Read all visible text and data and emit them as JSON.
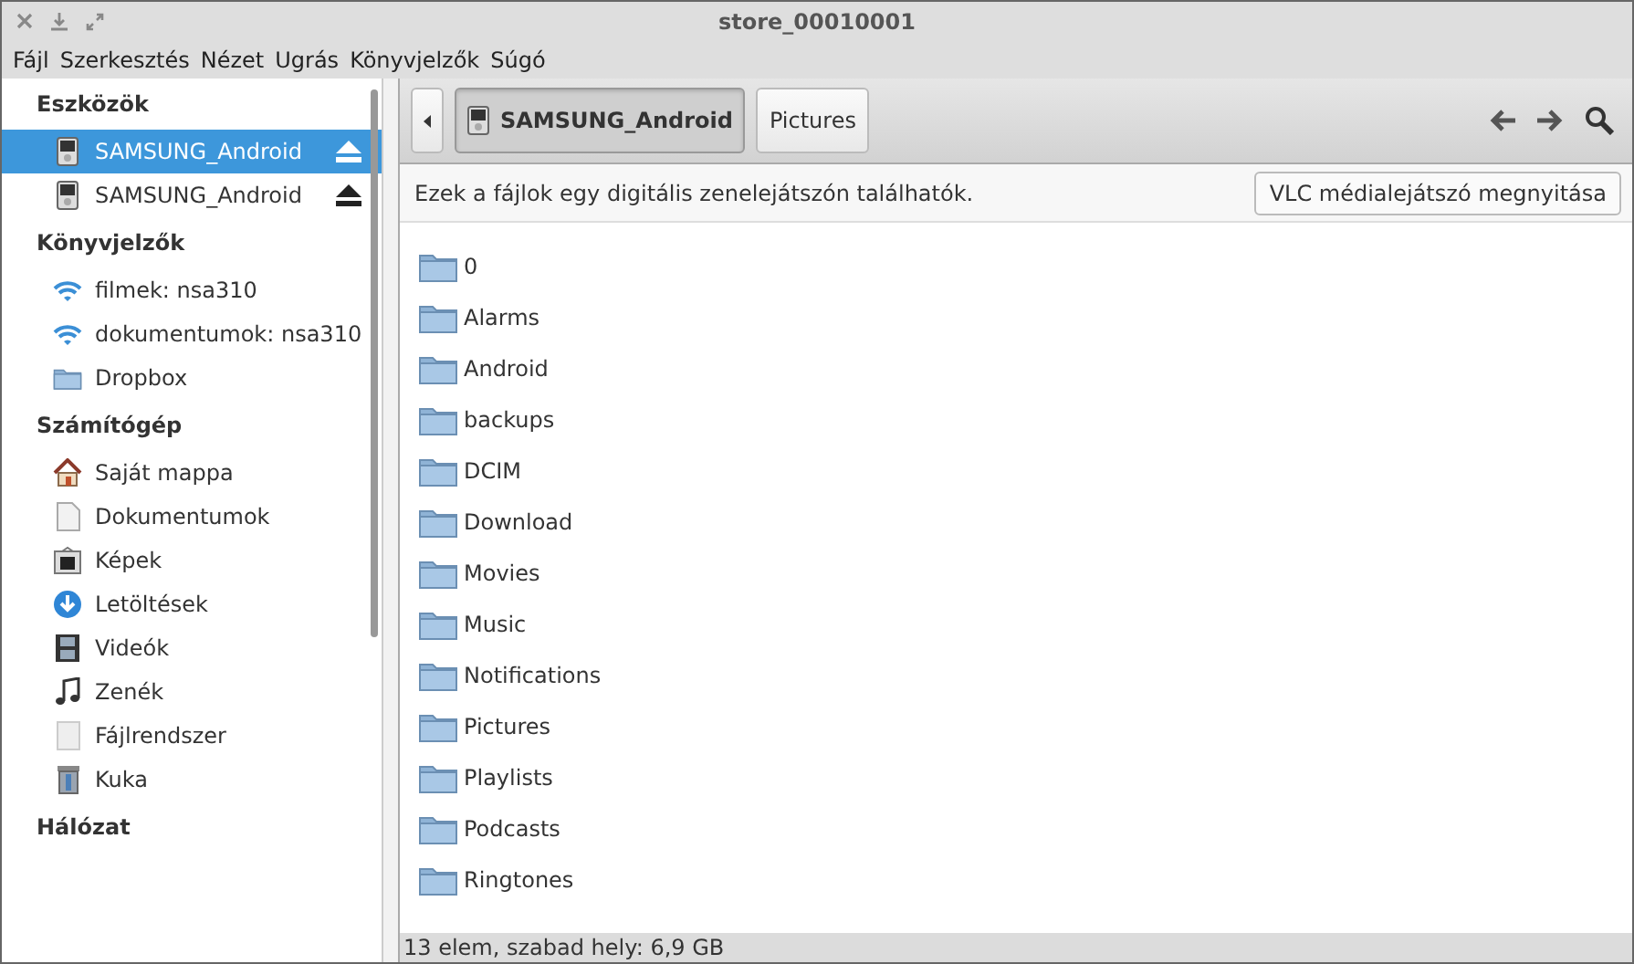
{
  "window": {
    "title": "store_00010001"
  },
  "menu": [
    "Fájl",
    "Szerkesztés",
    "Nézet",
    "Ugrás",
    "Könyvjelzők",
    "Súgó"
  ],
  "sidebar": {
    "sections": [
      {
        "heading": "Eszközök",
        "items": [
          {
            "label": "SAMSUNG_Android",
            "kind": "device",
            "selected": true,
            "ejectable": true
          },
          {
            "label": "SAMSUNG_Android",
            "kind": "device",
            "selected": false,
            "ejectable": true
          }
        ]
      },
      {
        "heading": "Könyvjelzők",
        "items": [
          {
            "label": "filmek: nsa310",
            "kind": "network",
            "selected": false,
            "ejectable": false
          },
          {
            "label": "dokumentumok: nsa310",
            "kind": "network",
            "selected": false,
            "ejectable": false
          },
          {
            "label": "Dropbox",
            "kind": "folder",
            "selected": false,
            "ejectable": false
          }
        ]
      },
      {
        "heading": "Számítógép",
        "items": [
          {
            "label": "Saját mappa",
            "kind": "home",
            "selected": false,
            "ejectable": false
          },
          {
            "label": "Dokumentumok",
            "kind": "document",
            "selected": false,
            "ejectable": false
          },
          {
            "label": "Képek",
            "kind": "pictures",
            "selected": false,
            "ejectable": false
          },
          {
            "label": "Letöltések",
            "kind": "download",
            "selected": false,
            "ejectable": false
          },
          {
            "label": "Videók",
            "kind": "video",
            "selected": false,
            "ejectable": false
          },
          {
            "label": "Zenék",
            "kind": "music",
            "selected": false,
            "ejectable": false
          },
          {
            "label": "Fájlrendszer",
            "kind": "drive",
            "selected": false,
            "ejectable": false
          },
          {
            "label": "Kuka",
            "kind": "trash",
            "selected": false,
            "ejectable": false
          }
        ]
      },
      {
        "heading": "Hálózat"
      }
    ]
  },
  "path": [
    {
      "label": "SAMSUNG_Android",
      "kind": "device",
      "selected": true
    },
    {
      "label": "Pictures",
      "kind": "folder",
      "selected": false
    }
  ],
  "info_bar": {
    "message": "Ezek a fájlok egy digitális zenelejátszón találhatók.",
    "button": "VLC médialejátszó megnyitása"
  },
  "files": [
    "0",
    "Alarms",
    "Android",
    "backups",
    "DCIM",
    "Download",
    "Movies",
    "Music",
    "Notifications",
    "Pictures",
    "Playlists",
    "Podcasts",
    "Ringtones"
  ],
  "status_bar": "13 elem, szabad hely: 6,9 GB"
}
